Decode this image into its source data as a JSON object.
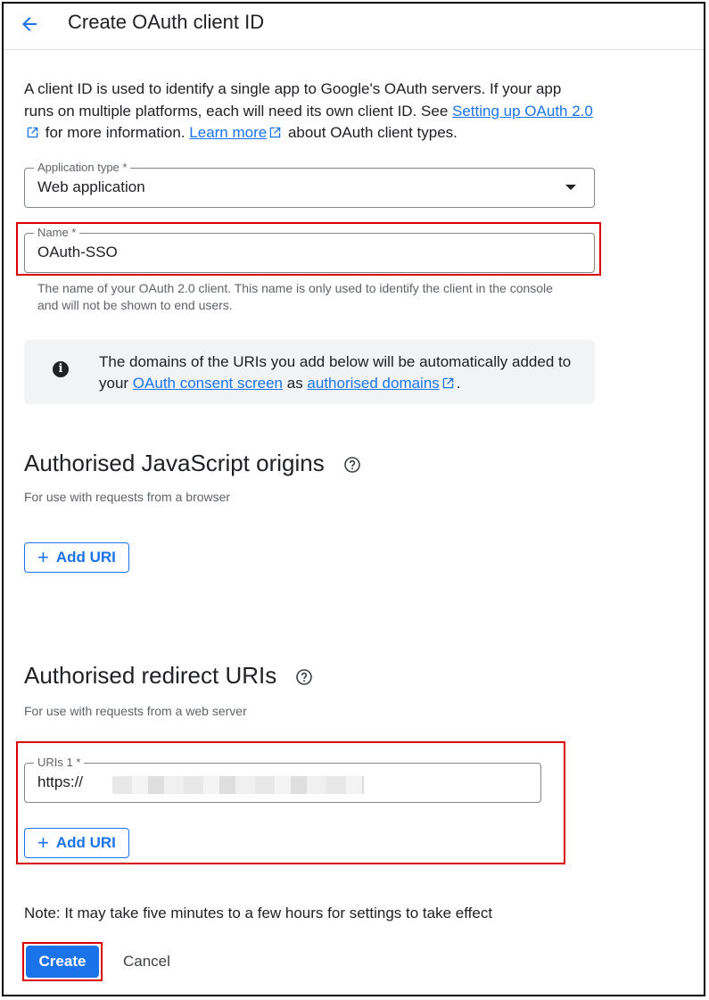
{
  "header": {
    "title": "Create OAuth client ID",
    "back_icon": "arrow-left-icon"
  },
  "intro": {
    "part1": "A client ID is used to identify a single app to Google's OAuth servers. If your app runs on multiple platforms, each will need its own client ID. See ",
    "link1": "Setting up OAuth 2.0",
    "part2": " for more information. ",
    "link2": "Learn more",
    "part3": " about OAuth client types."
  },
  "application_type": {
    "label": "Application type *",
    "value": "Web application"
  },
  "name_field": {
    "label": "Name *",
    "value": "OAuth-SSO",
    "hint": "The name of your OAuth 2.0 client. This name is only used to identify the client in the console and will not be shown to end users."
  },
  "info_box": {
    "part1": "The domains of the URIs you add below will be automatically added to your ",
    "link1": "OAuth consent screen",
    "part2": " as ",
    "link2": "authorised domains",
    "part3": "."
  },
  "js_origins": {
    "title": "Authorised JavaScript origins",
    "subtitle": "For use with requests from a browser",
    "add_label": "Add URI"
  },
  "redirect_uris": {
    "title": "Authorised redirect URIs",
    "subtitle": "For use with requests from a web server",
    "field_label": "URIs 1 *",
    "field_value": "https://",
    "add_label": "Add URI"
  },
  "footer": {
    "note": "Note: It may take five minutes to a few hours for settings to take effect",
    "create_label": "Create",
    "cancel_label": "Cancel"
  },
  "colors": {
    "accent": "#1a73e8",
    "highlight": "#d80000",
    "info_bg": "#f1f3f4"
  }
}
